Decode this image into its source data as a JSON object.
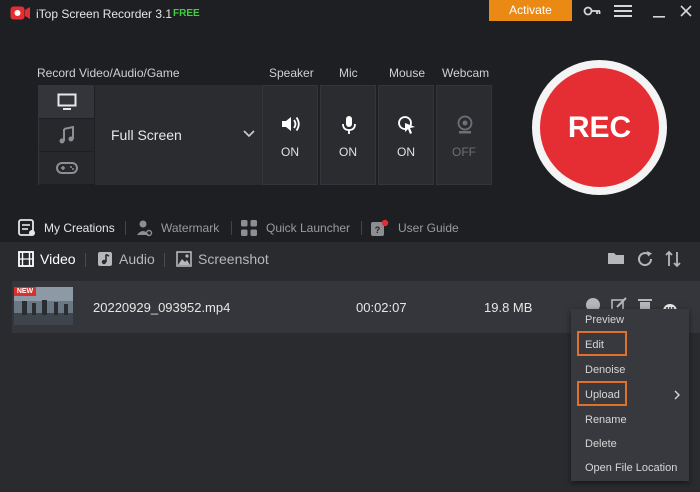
{
  "titlebar": {
    "title": "iTop Screen Recorder 3.1",
    "badge": "FREE",
    "activate_label": "Activate",
    "icons": [
      "recorder-logo-icon",
      "key-icon",
      "menu-icon",
      "minimize-icon",
      "close-icon"
    ]
  },
  "record": {
    "mode_label": "Record Video/Audio/Game",
    "mode_tabs": [
      "monitor-icon",
      "music-note-icon",
      "gamepad-icon"
    ],
    "mode_value": "Full Screen",
    "devices": [
      {
        "label": "Speaker",
        "state": "ON",
        "icon": "speaker-icon"
      },
      {
        "label": "Mic",
        "state": "ON",
        "icon": "microphone-icon"
      },
      {
        "label": "Mouse",
        "state": "ON",
        "icon": "mouse-cursor-icon"
      },
      {
        "label": "Webcam",
        "state": "OFF",
        "icon": "webcam-icon"
      }
    ],
    "rec_label": "REC"
  },
  "creations_bar": {
    "items": [
      {
        "label": "My Creations",
        "icon": "creations-icon"
      },
      {
        "label": "Watermark",
        "icon": "watermark-icon"
      },
      {
        "label": "Quick Launcher",
        "icon": "launcher-icon"
      },
      {
        "label": "User Guide",
        "icon": "guide-icon"
      }
    ]
  },
  "type_tabs": [
    {
      "label": "Video",
      "icon": "film-icon"
    },
    {
      "label": "Audio",
      "icon": "audio-icon"
    },
    {
      "label": "Screenshot",
      "icon": "image-icon"
    }
  ],
  "file": {
    "badge": "NEW",
    "name": "20220929_093952.mp4",
    "duration": "00:02:07",
    "size": "19.8 MB"
  },
  "context_menu": {
    "items": [
      "Preview",
      "Edit",
      "Denoise",
      "Upload",
      "Rename",
      "Delete",
      "Open File Location"
    ]
  },
  "colors": {
    "accent": "#ea8a14",
    "rec": "#e52d34",
    "highlight_box": "#e0702a",
    "free_badge": "#3fcf3f"
  }
}
